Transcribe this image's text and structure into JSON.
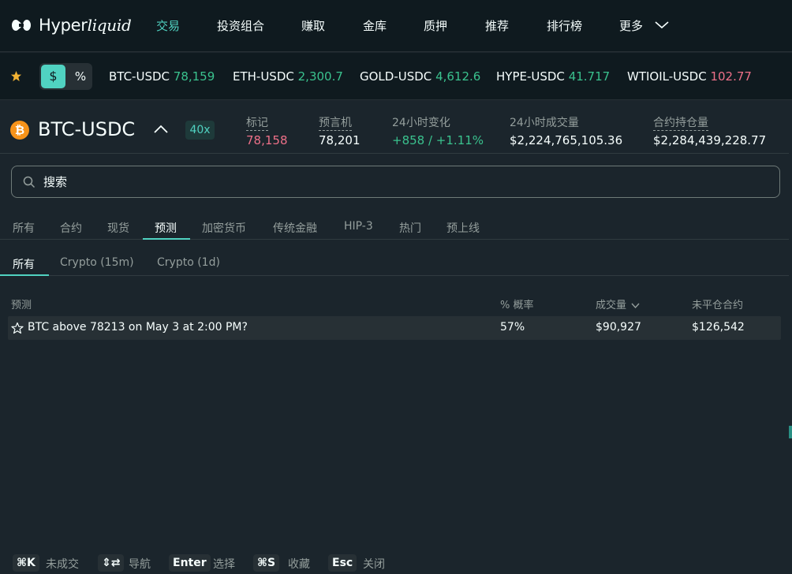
{
  "colors": {
    "accent": "#50d2c1",
    "up": "#3ac28e",
    "down": "#ed7088",
    "background": "#1b252c",
    "nav_background": "#0f1a1f",
    "muted": "#949e9c",
    "btc_orange": "#f7931a"
  },
  "brand": {
    "name_plain": "Hyper",
    "name_italic": "liquid"
  },
  "nav": {
    "items": [
      "交易",
      "投资组合",
      "赚取",
      "金库",
      "质押",
      "推荐",
      "排行榜",
      "更多"
    ],
    "active_index": 0
  },
  "ticker": {
    "toggle": {
      "dollar": "$",
      "percent": "%"
    },
    "items": [
      {
        "symbol": "BTC-USDC",
        "price": "78,159",
        "trend": "up"
      },
      {
        "symbol": "ETH-USDC",
        "price": "2,300.7",
        "trend": "up"
      },
      {
        "symbol": "GOLD-USDC",
        "price": "4,612.6",
        "trend": "up"
      },
      {
        "symbol": "HYPE-USDC",
        "price": "41.717",
        "trend": "up"
      },
      {
        "symbol": "WTIOIL-USDC",
        "price": "102.77",
        "trend": "down"
      }
    ]
  },
  "market": {
    "icon": "bitcoin-icon",
    "name": "BTC-USDC",
    "leverage": "40x",
    "stats": [
      {
        "label": "标记",
        "value": "78,158"
      },
      {
        "label": "预言机",
        "value": "78,201"
      },
      {
        "label": "24小时变化",
        "value": "+858 / +1.11%"
      },
      {
        "label": "24小时成交量",
        "value": "$2,224,765,105.36"
      },
      {
        "label": "合约持仓量",
        "value": "$2,284,439,228.77"
      }
    ]
  },
  "search": {
    "placeholder": "搜索",
    "value": ""
  },
  "category_tabs": {
    "items": [
      "所有",
      "合约",
      "现货",
      "预测",
      "加密货币",
      "传统金融",
      "HIP-3",
      "热门",
      "预上线"
    ],
    "active_index": 3
  },
  "sub_tabs": {
    "items": [
      "所有",
      "Crypto (15m)",
      "Crypto (1d)"
    ],
    "active_index": 0
  },
  "table": {
    "columns": [
      "预测",
      "% 概率",
      "成交量",
      "未平仓合约"
    ],
    "sorted_column": "成交量",
    "rows": [
      {
        "title": "BTC above 78213 on May 3 at 2:00 PM?",
        "probability": "57%",
        "volume": "$90,927",
        "open_interest": "$126,542"
      }
    ]
  },
  "shortcuts": [
    {
      "key": "⌘K",
      "label": "未成交"
    },
    {
      "key": "⇕⇄",
      "label": "导航"
    },
    {
      "key": "Enter",
      "label": "选择"
    },
    {
      "key": "⌘S",
      "label": "收藏"
    },
    {
      "key": "Esc",
      "label": "关闭"
    }
  ]
}
